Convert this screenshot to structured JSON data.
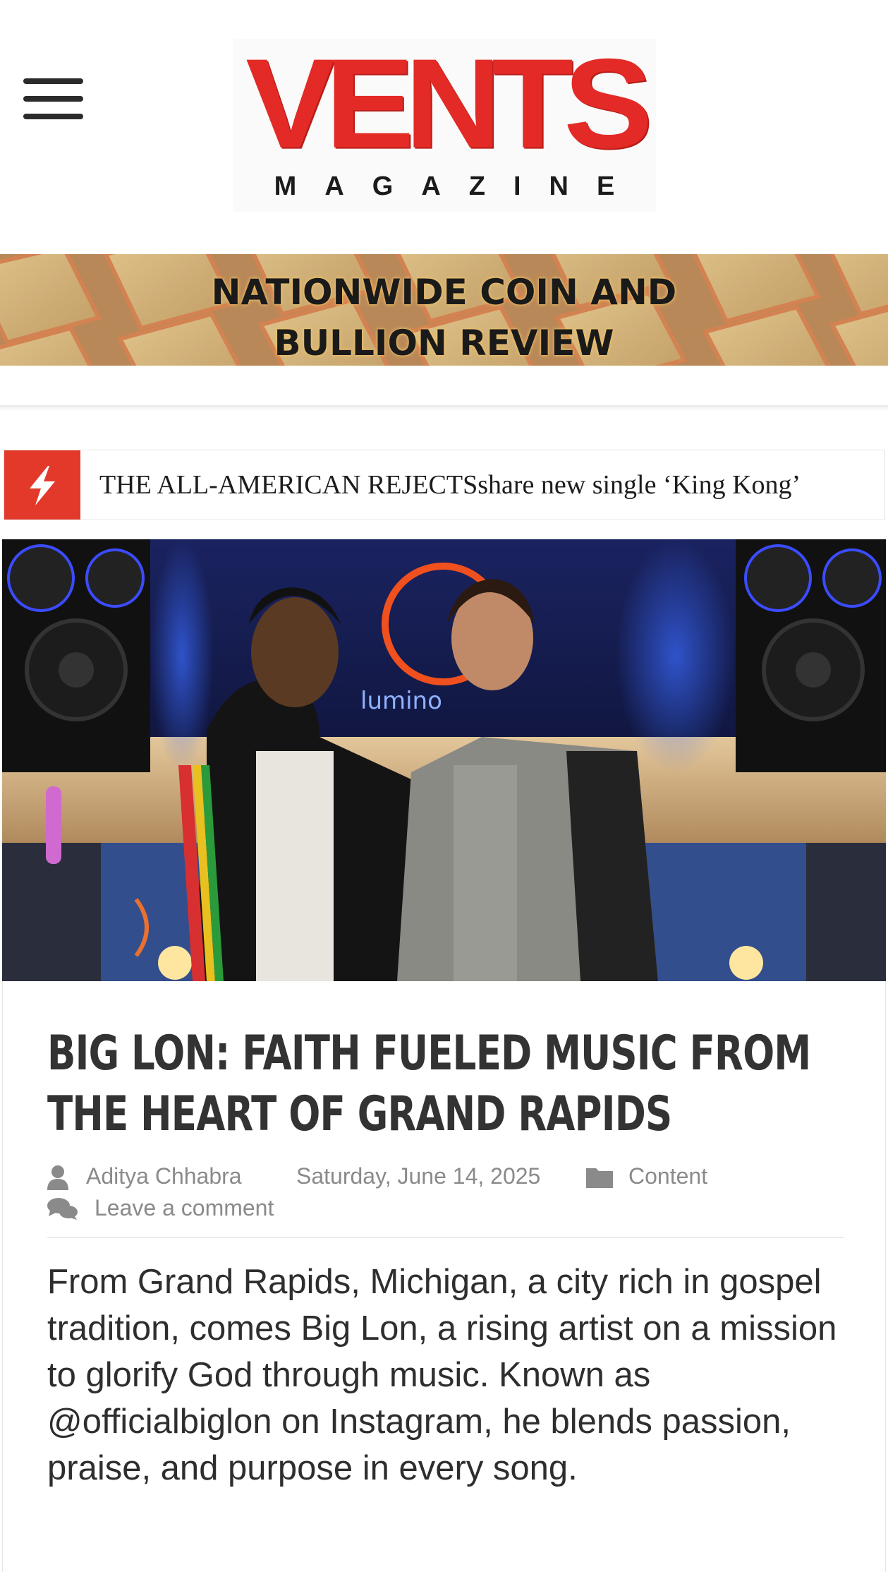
{
  "header": {
    "menu_icon": "hamburger-menu-icon",
    "logo": {
      "main": "VENTS",
      "sub": "MAGAZINE",
      "color": "#e32a26"
    }
  },
  "banner": {
    "line1": "NATIONWIDE COIN AND",
    "line2": "BULLION REVIEW"
  },
  "ticker": {
    "icon": "lightning-bolt-icon",
    "accent": "#e3392b",
    "text": "THE ALL-AMERICAN REJECTSshare new single ‘King Kong’"
  },
  "hero": {
    "sign_text": "lumino"
  },
  "article": {
    "title": "BIG LON: FAITH FUELED MUSIC FROM THE HEART OF GRAND RAPIDS",
    "author_icon": "user-icon",
    "author": "Aditya Chhabra",
    "date": "Saturday, June 14, 2025",
    "category_icon": "folder-icon",
    "category": "Content",
    "comment_icon": "comments-icon",
    "comment_link": "Leave a comment",
    "body": "From Grand Rapids, Michigan, a city rich in gospel tradition, comes Big Lon, a rising artist on a mission to glorify God through music. Known as @officialbiglon on Instagram, he blends passion, praise, and purpose in every song."
  }
}
